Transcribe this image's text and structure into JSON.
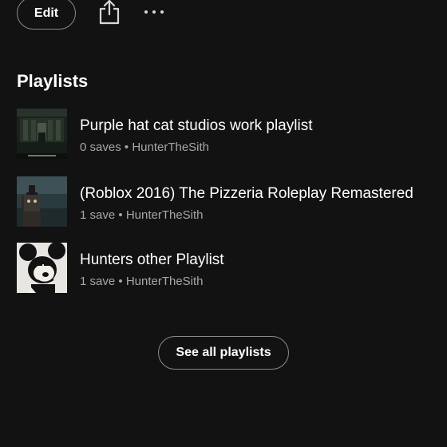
{
  "toolbar": {
    "edit_label": "Edit",
    "share_icon": "share-icon",
    "more_icon": "more-options-icon"
  },
  "playlists_section": {
    "title": "Playlists",
    "items": [
      {
        "title": "Purple hat cat studios work playlist",
        "saves": "0 saves",
        "separator": "•",
        "owner": "HunterTheSith"
      },
      {
        "title": "(Roblox 2016) The Pizzeria Roleplay Remastered",
        "saves": "1 save",
        "separator": "•",
        "owner": "HunterTheSith"
      },
      {
        "title": "Hunters other Playlist",
        "saves": "1 save",
        "separator": "•",
        "owner": "HunterTheSith"
      }
    ],
    "see_all_label": "See all playlists"
  },
  "colors": {
    "background": "#121212",
    "text_primary": "#ffffff",
    "text_secondary": "#a7a7a7",
    "button_border": "#8a8a8a"
  }
}
